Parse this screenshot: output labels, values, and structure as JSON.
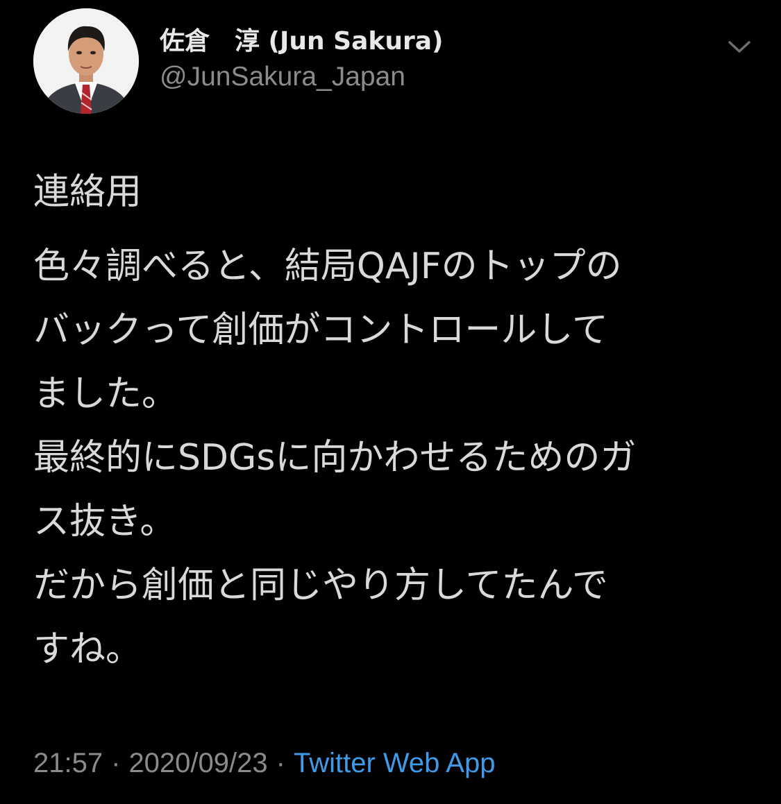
{
  "tweet": {
    "author": {
      "display_name": "佐倉　淳 (Jun Sakura)",
      "handle": "@JunSakura_Japan",
      "avatar_icon": "profile-photo"
    },
    "menu_icon": "chevron-down-icon",
    "heading": "連絡用",
    "lines": [
      "色々調べると、結局QAJFのトップの",
      "バックって創価がコントロールして",
      "ました。",
      "最終的にSDGsに向かわせるためのガ",
      "ス抜き。",
      "だから創価と同じやり方してたんで",
      "すね。"
    ],
    "time": "21:57",
    "separator": "·",
    "date": "2020/09/23",
    "source": "Twitter Web App"
  },
  "colors": {
    "background": "#000000",
    "text": "#d9d9d9",
    "muted": "#8b8b8b",
    "link": "#3f9bea"
  }
}
